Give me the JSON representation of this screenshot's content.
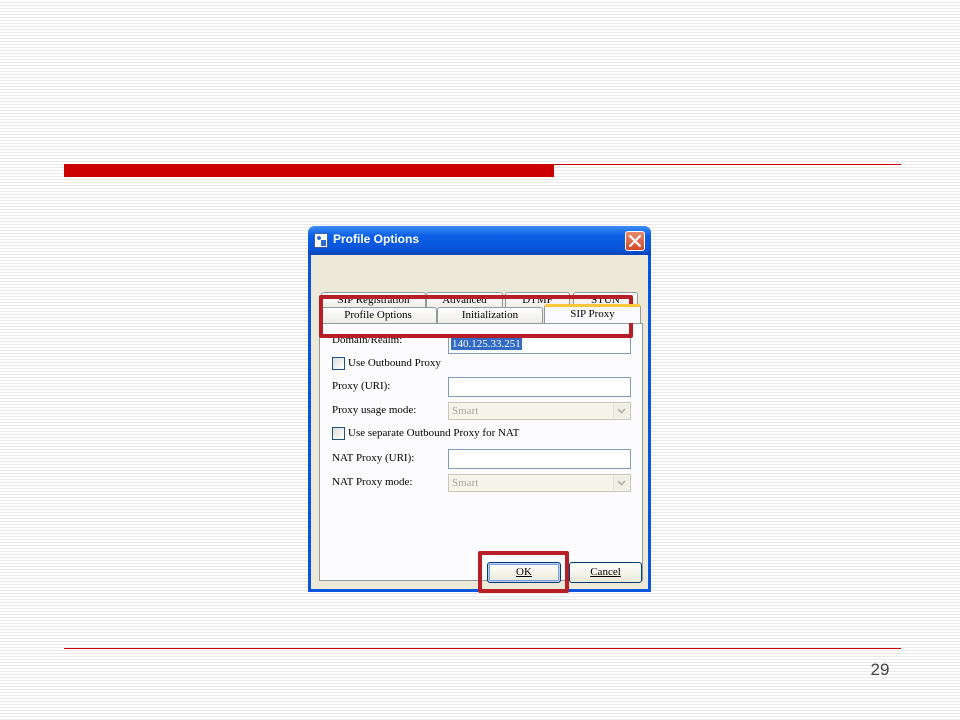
{
  "slide": {
    "page_number": "29"
  },
  "dialog": {
    "title": "Profile Options",
    "tabs_row1": [
      "SIP Registration",
      "Advanced",
      "DTMF",
      "STUN"
    ],
    "tabs_row2": [
      "Profile Options",
      "Initialization",
      "SIP Proxy"
    ],
    "active_tab": "SIP Proxy",
    "fields": {
      "domain_label": "Domain/Realm:",
      "domain_value": "140.125.33.251",
      "use_outbound_proxy_label": "Use Outbound Proxy",
      "proxy_uri_label": "Proxy (URI):",
      "proxy_uri_value": "",
      "proxy_usage_mode_label": "Proxy usage mode:",
      "proxy_usage_mode_value": "Smart",
      "separate_nat_label": "Use separate Outbound Proxy for NAT",
      "nat_proxy_uri_label": "NAT Proxy (URI):",
      "nat_proxy_uri_value": "",
      "nat_proxy_mode_label": "NAT Proxy mode:",
      "nat_proxy_mode_value": "Smart"
    },
    "buttons": {
      "ok_label": "OK",
      "cancel_label": "Cancel"
    }
  },
  "colors": {
    "accent_red": "#cc0000",
    "highlight_red": "#b81e25",
    "xp_blue": "#0a55e0"
  },
  "icons": [
    "app-icon",
    "close-icon",
    "dropdown-arrow-icon"
  ]
}
